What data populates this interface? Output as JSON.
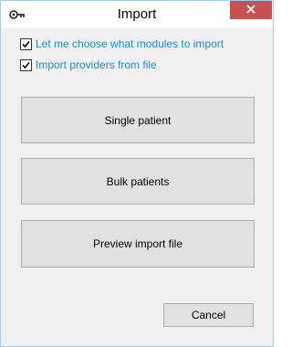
{
  "window": {
    "title": "Import",
    "app_icon": "key-icon",
    "close_icon": "close-icon"
  },
  "options": [
    {
      "label": "Let me choose what modules to import",
      "checked": true
    },
    {
      "label": "Import providers from file",
      "checked": true
    }
  ],
  "buttons": {
    "single_patient": "Single patient",
    "bulk_patients": "Bulk patients",
    "preview_import_file": "Preview import file",
    "cancel": "Cancel"
  },
  "colors": {
    "accent_text": "#1a8cd8",
    "close_button": "#c75050",
    "border": "#9ed0ee"
  }
}
